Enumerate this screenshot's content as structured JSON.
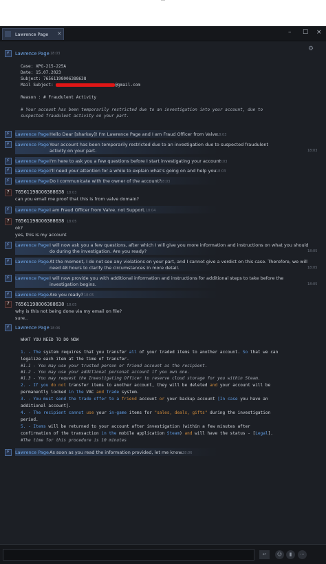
{
  "window": {
    "tab_title": "Lawrence Page",
    "tab_close": "×",
    "ctl_min": "–",
    "ctl_max": "☐",
    "ctl_close": "×"
  },
  "messages": {
    "m1": {
      "name": "Lawrence Page",
      "time": "18:03",
      "case": "Case: XPG-215-225A",
      "date": "Date: 15.07.2023",
      "subject": "Subject: 76561198006388638",
      "mail_subject_prefix": "Mail Subject: ",
      "mail_subject_suffix": "@gmail.com",
      "reason": "Reason : # Fraudulent Activity",
      "note_1": "# Your account has been temporarily restricted due to an investigation into your account, due to",
      "note_2": "suspected fraudulent activity on your part."
    },
    "m2": {
      "name": "Lawrence Page",
      "text": "Hello Dear [sharkey]! I'm Lawrence Page and I am Fraud Officer from Valve.",
      "time": "18:03"
    },
    "m3": {
      "name": "Lawrence Page",
      "text_1": "Your account has been temporarily restricted due to an investigation due to suspected fraudulent",
      "text_2": "activity on your part.",
      "time": "18:03"
    },
    "m4": {
      "name": "Lawrence Page",
      "text": "I'm here to ask you a few questions before I start investigating your account",
      "time": "18:03"
    },
    "m5": {
      "name": "Lawrence Page",
      "text": "I'll need your attention for a while to explain what's going on and help you.",
      "time": "18:03"
    },
    "m6": {
      "name": "Lawrence Page",
      "text": "Do I communicate with the owner of the account?",
      "time": "18:03"
    },
    "m7": {
      "name": "76561198006388638",
      "time": "18:03",
      "text": "can you email me proof that this is from valve domain?"
    },
    "m8": {
      "name": "Lawrence Page",
      "text": "I am Fraud Officer from Valve. not Support.",
      "time": "18:04"
    },
    "m9": {
      "name": "76561198006388638",
      "time": "18:05",
      "text_1": "ok?",
      "text_2": "yes, this is my account"
    },
    "m10": {
      "name": "Lawrence Page",
      "text_1": "I will now ask you a few questions, after which I will give you more information and instructions on what you should",
      "text_2": "do during the investigation. Are you ready?",
      "time": "18:05"
    },
    "m11": {
      "name": "Lawrence Page",
      "text_1": "At the moment, I do not see any violations on your part, and I cannot give a verdict on this case. Therefore, we will",
      "text_2": "need 48 hours to clarify the circumstances in more detail.",
      "time": "18:05"
    },
    "m12": {
      "name": "Lawrence Page",
      "text_1": "I will now provide you with additional information and instructions for additional steps to take before the",
      "text_2": "investigation begins.",
      "time": "18:05"
    },
    "m13": {
      "name": "Lawrence Page",
      "text": "Are you ready?",
      "time": "18:05"
    },
    "m14": {
      "name": "76561198006388638",
      "time": "18:05",
      "text_1": "why is this not being done via my email on file?",
      "text_2": "sure.."
    },
    "m15": {
      "name": "Lawrence Page",
      "time": "18:06",
      "heading": "WHAT YOU NEED TO DO NOW",
      "l1a": "1. - ",
      "l1b": "The",
      "l1c": " system requires that you transfer ",
      "l1d": "all",
      "l1e": " of your traded items to another account. ",
      "l1f": "So",
      "l1g": " that we can",
      "l2": "legalize each item at the time of transfer.",
      "l3": "#1.1 - You may use your trusted person or friend account as the recipient.",
      "l4": "#1.2 - You may use your additional personal account if you own one.",
      "l5": "#1.3 - You may request the Investigating Officer to reserve cloud storage for you within Steam.",
      "l6a": "2. - If you ",
      "l6b": "do not",
      "l6c": " transfer items to another account, they will be deleted ",
      "l6d": "and",
      "l6e": " your account will be",
      "l7a": "permanently locked ",
      "l7b": "in the",
      "l7c": " VAC ",
      "l7d": "and",
      "l7e": " Trade",
      "l7f": " system.",
      "l8a": "3. - You must send the trade offer to a ",
      "l8b": "friend",
      "l8c": " account ",
      "l8d": "or",
      "l8e": " your backup account ",
      "l8f": "[In case",
      "l8g": " you have an",
      "l9": "additional account].",
      "l10a": "4. - The recipient cannot ",
      "l10b": "use",
      "l10c": " your ",
      "l10d": "in-game",
      "l10e": " items for ",
      "l10f": "\"sales, deals, gifts\"",
      "l10g": " during the investigation",
      "l11": "period.",
      "l12a": "5. - ",
      "l12b": "Items",
      "l12c": " will be returned to your account after investigation (within a few minutes after",
      "l13a": "confirmation of the transaction ",
      "l13b": "in the",
      "l13c": " mobile application ",
      "l13d": "Steam",
      "l13e": ") ",
      "l13f": "and",
      "l13g": " will have the status - [",
      "l13h": "Legal",
      "l13i": "].",
      "l14": "#The time for this procedure is 10 minutes"
    },
    "m16": {
      "name": "Lawrence Page",
      "text": "As soon as you read the information provided, let me know.",
      "time": "18:06"
    }
  },
  "composer": {
    "input_value": "",
    "send_glyph": "↩",
    "emoji_glyph": "☺",
    "mic_glyph": "▮",
    "more_glyph": "⋯"
  },
  "icons": {
    "avatar_glyph": "⚡",
    "question_glyph": "?",
    "gear_glyph": "⚙"
  },
  "colors": {
    "bg": "#1c1f25",
    "link_blue": "#6fa6e8",
    "text": "#c8ccd3",
    "highlight": "#466eaa"
  }
}
